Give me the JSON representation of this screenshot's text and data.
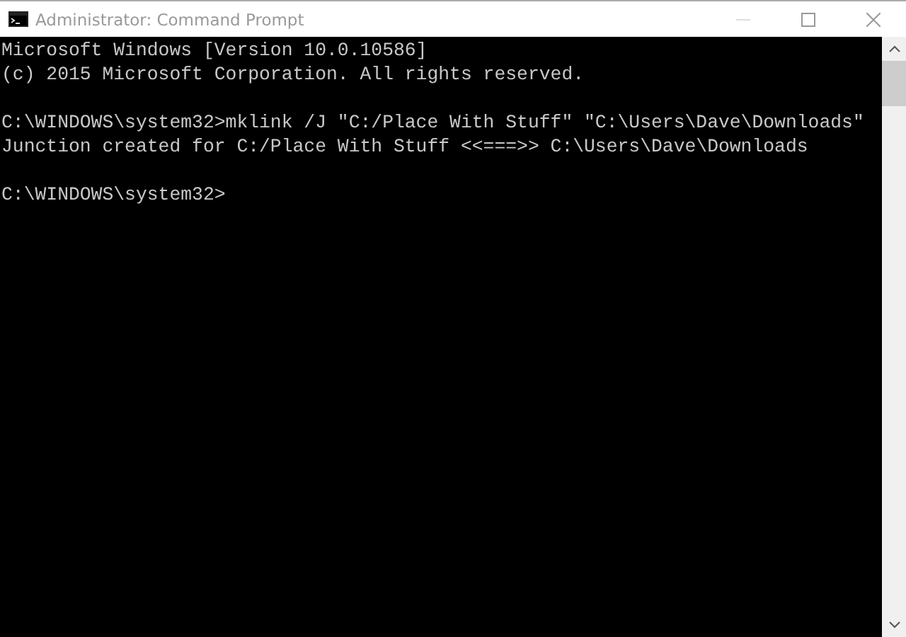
{
  "window": {
    "title": "Administrator: Command Prompt"
  },
  "console": {
    "blocks": [
      {
        "lines": [
          "Microsoft Windows [Version 10.0.10586]",
          "(c) 2015 Microsoft Corporation. All rights reserved."
        ]
      },
      {
        "lines": [
          "C:\\WINDOWS\\system32>mklink /J \"C:/Place With Stuff\" \"C:\\Users\\Dave\\Downloads\"",
          "Junction created for C:/Place With Stuff <<===>> C:\\Users\\Dave\\Downloads"
        ]
      },
      {
        "lines": [
          "C:\\WINDOWS\\system32>"
        ]
      }
    ]
  }
}
